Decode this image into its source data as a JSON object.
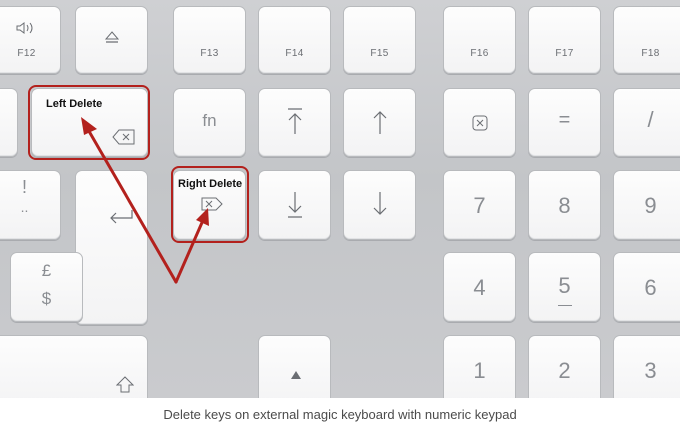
{
  "photo": {
    "keys": {
      "f12": "F12",
      "f13": "F13",
      "f14": "F14",
      "f15": "F15",
      "f16": "F16",
      "f17": "F17",
      "f18": "F18",
      "fn": "fn",
      "equals": "=",
      "slash": "/",
      "seven": "7",
      "eight": "8",
      "nine": "9",
      "four": "4",
      "five": "5",
      "six": "6",
      "one": "1",
      "two": "2",
      "three": "3",
      "exclaim": "!",
      "dots": "..",
      "pound": "£",
      "dollar": "$"
    },
    "annotations": {
      "left_delete": "Left Delete",
      "right_delete": "Right Delete"
    },
    "annotation_color": "#b3211d"
  },
  "caption": "Delete keys on external magic keyboard with numeric keypad"
}
